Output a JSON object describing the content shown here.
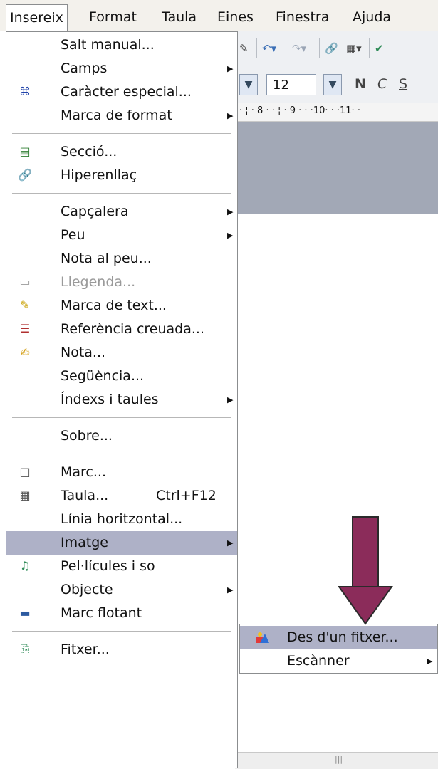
{
  "menubar": {
    "items": [
      {
        "label": "Insereix"
      },
      {
        "label": "Format"
      },
      {
        "label": "Taula"
      },
      {
        "label": "Eines"
      },
      {
        "label": "Finestra"
      },
      {
        "label": "Ajuda"
      }
    ]
  },
  "toolbar": {
    "font_size": "12",
    "bold": "N",
    "italic": "C",
    "underline": "S",
    "ruler_text": "· ¦ · 8 · · ¦ · 9 · · ·10· · ·11· ·"
  },
  "menu": {
    "items": [
      {
        "label": "Salt manual...",
        "icon": "none"
      },
      {
        "label": "Camps",
        "submenu": true
      },
      {
        "label": "Caràcter especial...",
        "icon": "special-char-icon"
      },
      {
        "label": "Marca de format",
        "submenu": true
      },
      {
        "label": "Secció...",
        "icon": "section-icon"
      },
      {
        "label": "Hiperenllaç",
        "icon": "hyperlink-icon"
      },
      {
        "label": "Capçalera",
        "submenu": true
      },
      {
        "label": "Peu",
        "submenu": true
      },
      {
        "label": "Nota al peu..."
      },
      {
        "label": "Llegenda...",
        "disabled": true,
        "icon": "caption-icon"
      },
      {
        "label": "Marca de text...",
        "icon": "bookmark-icon"
      },
      {
        "label": "Referència creuada...",
        "icon": "cross-reference-icon"
      },
      {
        "label": "Nota...",
        "icon": "note-icon"
      },
      {
        "label": "Següència..."
      },
      {
        "label": "Índexs i taules",
        "submenu": true
      },
      {
        "label": "Sobre..."
      },
      {
        "label": "Marc...",
        "icon": "frame-icon"
      },
      {
        "label": "Taula...",
        "shortcut": "Ctrl+F12",
        "icon": "table-icon"
      },
      {
        "label": "Línia horitzontal..."
      },
      {
        "label": "Imatge",
        "submenu": true,
        "highlighted": true
      },
      {
        "label": "Pel·lícules i so",
        "icon": "movie-sound-icon"
      },
      {
        "label": "Objecte",
        "submenu": true
      },
      {
        "label": "Marc flotant",
        "icon": "floating-frame-icon"
      },
      {
        "label": "Fitxer...",
        "icon": "file-icon"
      }
    ]
  },
  "submenu": {
    "items": [
      {
        "label": "Des d'un fitxer...",
        "icon": "from-file-image-icon",
        "highlighted": true
      },
      {
        "label": "Escànner",
        "submenu": true
      }
    ]
  },
  "annotation": {
    "arrow_color": "#8b2c5a"
  }
}
